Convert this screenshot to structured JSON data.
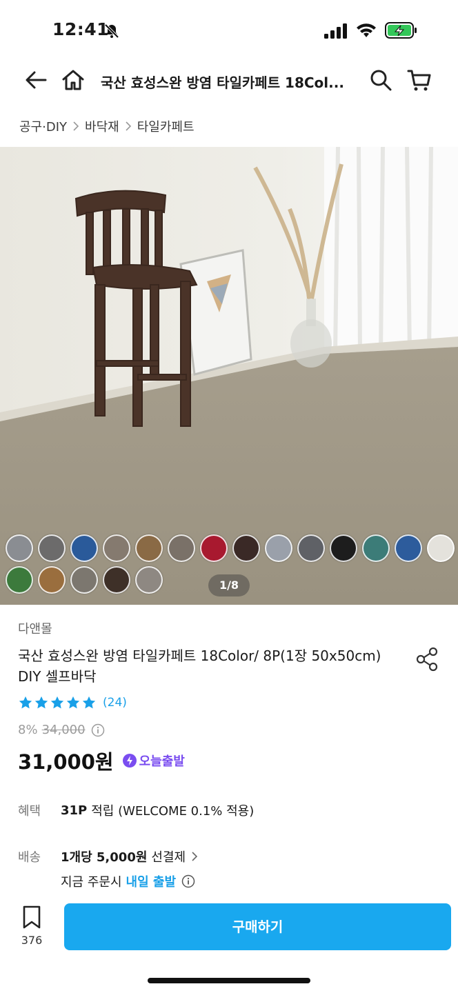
{
  "status_bar": {
    "time": "12:41"
  },
  "nav": {
    "title": "국산 효성스완 방염 타일카페트 18Col..."
  },
  "breadcrumb": [
    "공구·DIY",
    "바닥재",
    "타일카페트"
  ],
  "gallery": {
    "page_indicator": "1/8",
    "swatch_colors": [
      "#8a8d92",
      "#6c6b6b",
      "#2a5a9a",
      "#857a6f",
      "#8a6a45",
      "#7a7168",
      "#a8192f",
      "#3a2926",
      "#9aa0aa",
      "#5f6166",
      "#1d1d1d",
      "#3c7c78",
      "#2d5c9c",
      "#e4e2dc",
      "#3c7a3c",
      "#9a6e3e",
      "#7c776f",
      "#3e3028",
      "#8e8882"
    ]
  },
  "product": {
    "seller": "다앤몰",
    "name": "국산 효성스완 방염 타일카페트 18Color/ 8P(1장 50x50cm) DIY 셀프바닥",
    "rating_stars": 5,
    "review_count": "(24)",
    "discount": "8%",
    "original_price": "34,000",
    "price": "31,000원",
    "badge": "오늘출발"
  },
  "benefit": {
    "label": "혜택",
    "points": "31P",
    "text": "적립 (WELCOME 0.1% 적용)"
  },
  "shipping": {
    "label": "배송",
    "fee": "1개당 5,000원",
    "fee_suffix": "선결제",
    "eta_prefix": "지금 주문시",
    "eta": "내일 출발"
  },
  "bottom": {
    "bookmark_count": "376",
    "buy_label": "구매하기"
  },
  "colors": {
    "accent": "#19a8ef",
    "badge": "#7a4df0"
  }
}
